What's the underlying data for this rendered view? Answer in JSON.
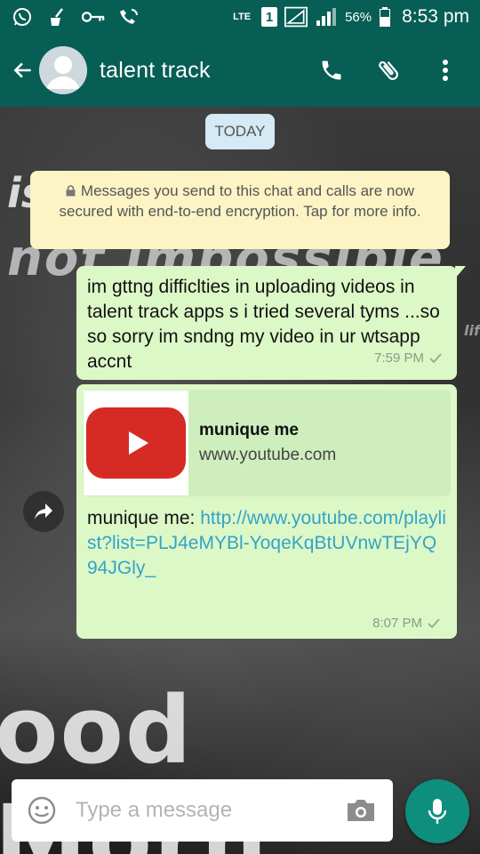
{
  "status_bar": {
    "network": "LTE",
    "sim_slot": "1",
    "battery": "56%",
    "time": "8:53 pm"
  },
  "app_bar": {
    "contact_name": "talent track"
  },
  "chat": {
    "date_chip": "TODAY",
    "encryption_notice": "Messages you send to this chat and calls are now secured with end-to-end encryption. Tap for more info.",
    "messages": [
      {
        "text": "im gttng difficlties in uploading videos in talent track apps s i tried several tyms ...so so sorry im sndng my video in ur wtsapp accnt",
        "time": "7:59 PM"
      },
      {
        "preview_title": "munique me",
        "preview_domain": "www.youtube.com",
        "text_prefix": "munique me: ",
        "link": "http://www.youtube.com/playlist?list=PLJ4eMYBl-YoqeKqBtUVnwTEjYQ94JGly_",
        "time": "8:07 PM"
      }
    ]
  },
  "wallpaper": {
    "line1": "is",
    "line2": "not impossible",
    "line3": "ood Morn",
    "side": "lif"
  },
  "composer": {
    "placeholder": "Type a message"
  },
  "colors": {
    "header": "#075e54",
    "outgoing_bubble": "#dcf8c6",
    "link": "#34a3c9",
    "mic_button": "#0e8f7e"
  }
}
